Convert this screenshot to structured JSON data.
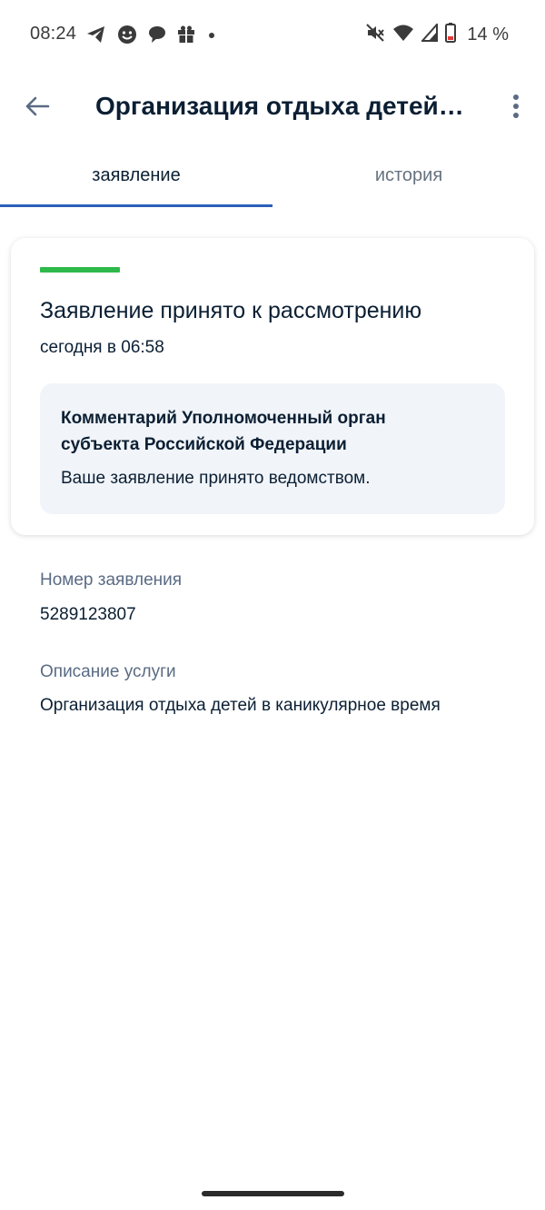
{
  "status_bar": {
    "time": "08:24",
    "notification_icons": [
      "telegram-icon",
      "chat-face-icon",
      "speech-bubble-icon",
      "gift-icon",
      "dot-icon"
    ],
    "system_icons": [
      "mute-icon",
      "wifi-icon",
      "signal-icon",
      "battery-icon"
    ],
    "battery_text": "14 %"
  },
  "app_bar": {
    "title": "Организация отдыха детей в каникулярное время"
  },
  "tabs": [
    {
      "label": "заявление",
      "active": true
    },
    {
      "label": "история",
      "active": false
    }
  ],
  "status_card": {
    "status_color": "#2eb94a",
    "title": "Заявление принято к рассмотрению",
    "time": "сегодня в 06:58",
    "comment": {
      "title": "Комментарий Уполномоченный орган субъекта Российской Федерации",
      "text": "Ваше заявление принято ведомством."
    }
  },
  "details": {
    "number_label": "Номер заявления",
    "number_value": "5289123807",
    "description_label": "Описание услуги",
    "description_value": "Организация отдыха детей в каникулярное время"
  },
  "colors": {
    "accent": "#2b5fb8",
    "text_primary": "#0b1f33",
    "text_secondary": "#5a6b84",
    "comment_bg": "#f1f4f9"
  }
}
